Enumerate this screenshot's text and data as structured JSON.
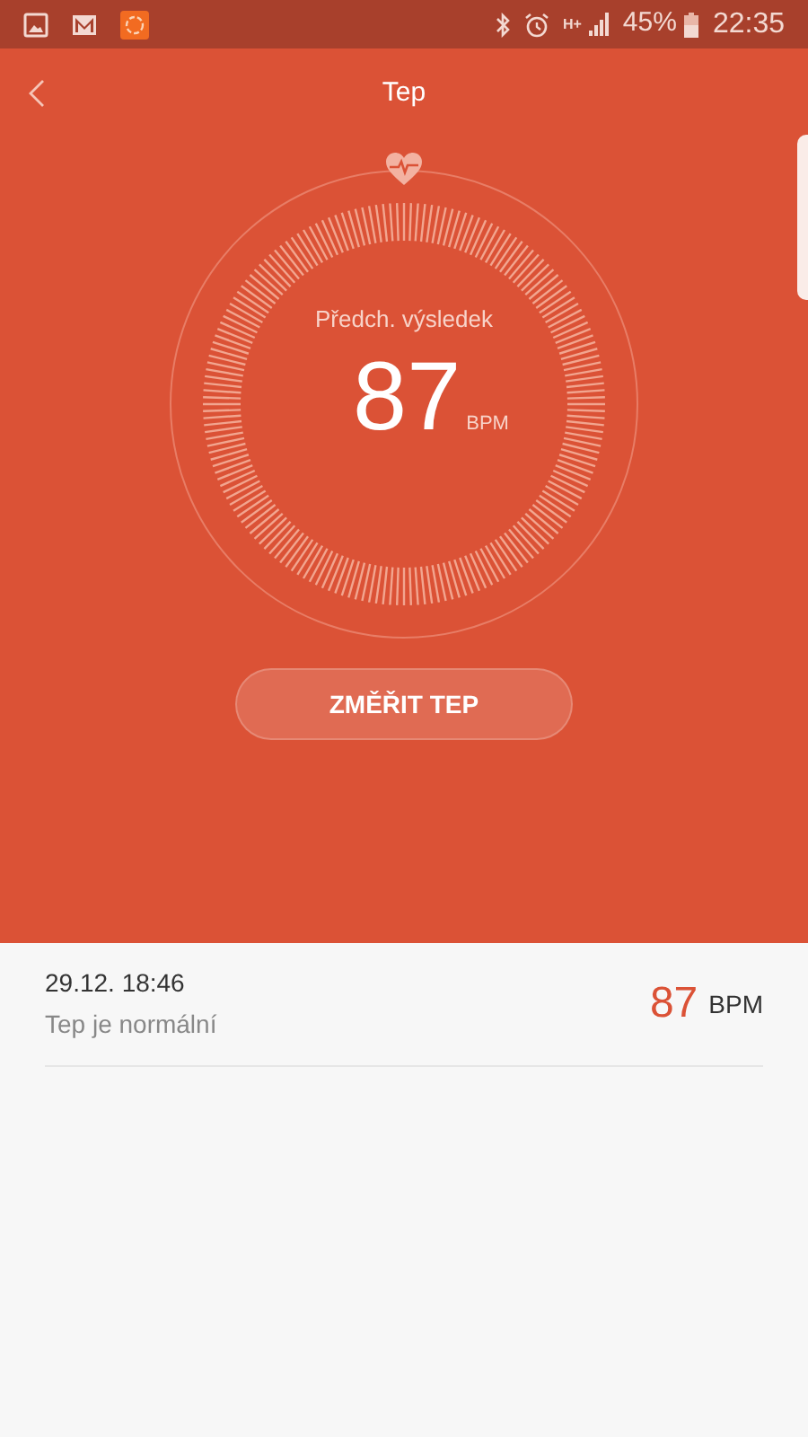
{
  "status_bar": {
    "network": "H+",
    "battery_text": "45%",
    "time": "22:35"
  },
  "header": {
    "title": "Tep"
  },
  "gauge": {
    "label": "Předch. výsledek",
    "value": "87",
    "unit": "BPM"
  },
  "measure_button": {
    "label": "ZMĚŘIT TEP"
  },
  "history": [
    {
      "date": "29.12. 18:46",
      "status": "Tep je normální",
      "value": "87",
      "unit": "BPM"
    }
  ]
}
